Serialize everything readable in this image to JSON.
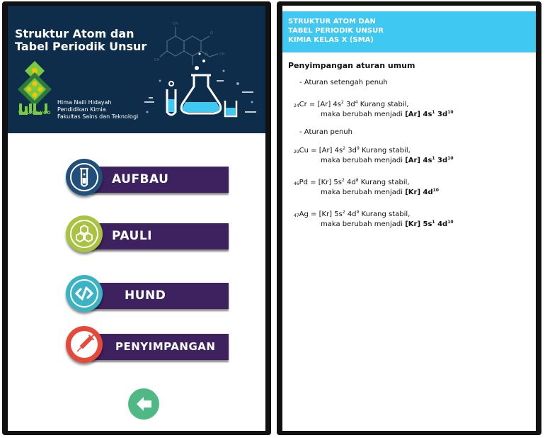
{
  "left": {
    "header": {
      "title_line1": "Struktur Atom dan",
      "title_line2": "Tabel Periodik Unsur",
      "logo_text": "WALISONGO",
      "credit_line1": "Hima Naili Hidayah",
      "credit_line2": "Pendidikan Kimia",
      "credit_line3": "Fakultas Sains dan Teknologi"
    },
    "menu": [
      {
        "label": "AUFBAU",
        "icon": "test-tube-icon",
        "color": "#1f4f7a"
      },
      {
        "label": "PAULI",
        "icon": "hexagon-molecule-icon",
        "color": "#a9c23f"
      },
      {
        "label": "HUND",
        "icon": "code-brackets-icon",
        "color": "#3bb3c3"
      },
      {
        "label": "PENYIMPANGAN",
        "icon": "syringe-icon",
        "color": "#e5493a"
      }
    ],
    "back_icon": "arrow-left-icon"
  },
  "right": {
    "header": {
      "line1": "STRUKTUR ATOM DAN",
      "line2": "TABEL PERIODIK UNSUR",
      "line3": "KIMIA KELAS X (SMA)"
    },
    "heading": "Penyimpangan aturan umum",
    "rule_half": "- Aturan setengah penuh",
    "rule_full": "- Aturan penuh",
    "cr": {
      "z": "24",
      "sym": "Cr",
      "config": "= [Ar] 4s",
      "e1": "2",
      "mid": " 3d",
      "e2": "4",
      "tail": " Kurang stabil,",
      "line2": "maka berubah menjadi ",
      "final": "[Ar] 4s",
      "f1": "1",
      "fmid": " 3d",
      "f2": "10"
    },
    "cu": {
      "z": "29",
      "sym": "Cu",
      "config": " = [Ar] 4s",
      "e1": "2",
      "mid": " 3d",
      "e2": "9",
      "tail": " Kurang stabil,",
      "line2": "maka berubah menjadi ",
      "final": "[Ar] 4s",
      "f1": "1",
      "fmid": " 3d",
      "f2": "10"
    },
    "pd": {
      "z": "46",
      "sym": "Pd",
      "config": " = [Kr] 5s",
      "e1": "2",
      "mid": " 4d",
      "e2": "8",
      "tail": " Kurang stabil,",
      "line2": "maka berubah menjadi ",
      "final": "[Kr] 4d",
      "f2": "10"
    },
    "ag": {
      "z": "47",
      "sym": "Ag",
      "config": " = [Kr] 5s",
      "e1": "2",
      "mid": " 4d",
      "e2": "9",
      "tail": " Kurang stabil,",
      "line2": "maka berubah menjadi ",
      "final": "[Kr] 5s",
      "f1": "1",
      "fmid": " 4d",
      "f2": "10"
    }
  },
  "colors": {
    "header_navy": "#0e2d4a",
    "button_purple": "#3e215f",
    "right_header_cyan": "#3fc8f2",
    "back_green": "#4fb985"
  }
}
